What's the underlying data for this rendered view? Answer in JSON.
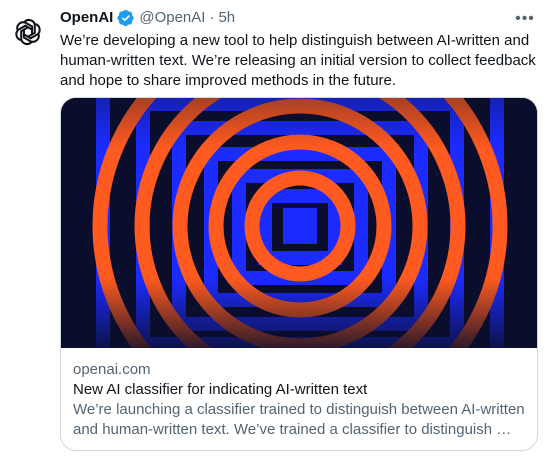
{
  "author": {
    "name": "OpenAI",
    "handle": "@OpenAI",
    "separator": "·",
    "time": "5h",
    "avatar_icon": "openai-logo-icon",
    "verified_icon": "verified-badge-icon",
    "verified_color": "#1d9bf0"
  },
  "more_icon": "more-options-icon",
  "tweet_text": "We’re developing a new tool to help distinguish between AI-written and\nhuman-written text. We’re releasing an initial version to collect feedback\nand hope to share improved methods in the future.",
  "card": {
    "domain": "openai.com",
    "title": "New AI classifier for indicating AI-written text",
    "description": "We’re launching a classifier trained to distinguish between AI-written\nand human-written text. We’ve trained a classifier to distinguish …",
    "image_colors": {
      "background": "#0a0e2c",
      "blue": "#1c2bff",
      "orange": "#ff5a1f"
    }
  }
}
